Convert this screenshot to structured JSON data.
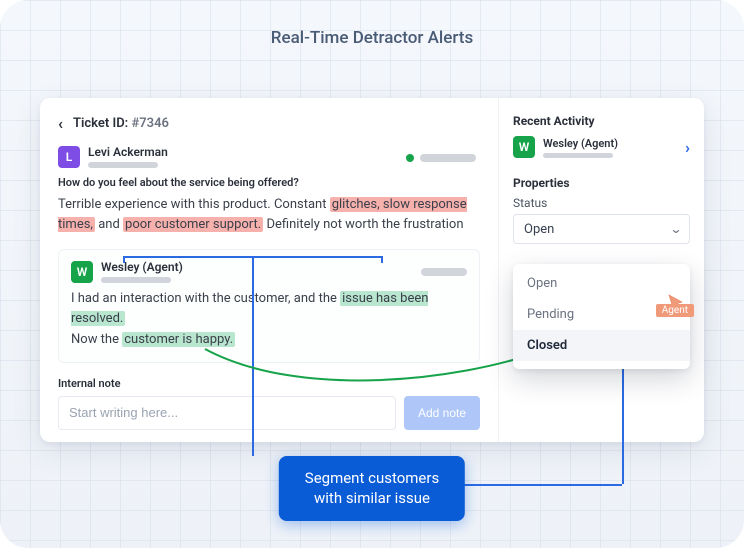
{
  "title": "Real-Time Detractor Alerts",
  "ticket": {
    "label": "Ticket ID:",
    "id": "#7346"
  },
  "customer": {
    "initial": "L",
    "name": "Levi Ackerman",
    "question": "How do you feel about the service being offered?",
    "body_pre": "Terrible experience with this product. Constant ",
    "hl1": "glitches, slow response times,",
    "body_mid": " and ",
    "hl2": "poor customer support.",
    "body_post": " Definitely not worth the frustration"
  },
  "agent_reply": {
    "initial": "W",
    "name": "Wesley (Agent)",
    "line1_pre": "I had an interaction with the customer, and the ",
    "line1_hl": "issue has been resolved.",
    "line2_pre": "Now the ",
    "line2_hl": "customer is happy."
  },
  "internal_note": {
    "label": "Internal note",
    "placeholder": "Start writing here...",
    "button": "Add note"
  },
  "sidebar": {
    "recent_activity": "Recent Activity",
    "agent_initial": "W",
    "agent_name": "Wesley (Agent)",
    "properties": "Properties",
    "status_label": "Status",
    "status_value": "Open",
    "options": [
      "Open",
      "Pending",
      "Closed"
    ],
    "selected_option": "Closed",
    "cursor_label": "Agent"
  },
  "callout": {
    "line1": "Segment customers",
    "line2": "with similar issue"
  }
}
